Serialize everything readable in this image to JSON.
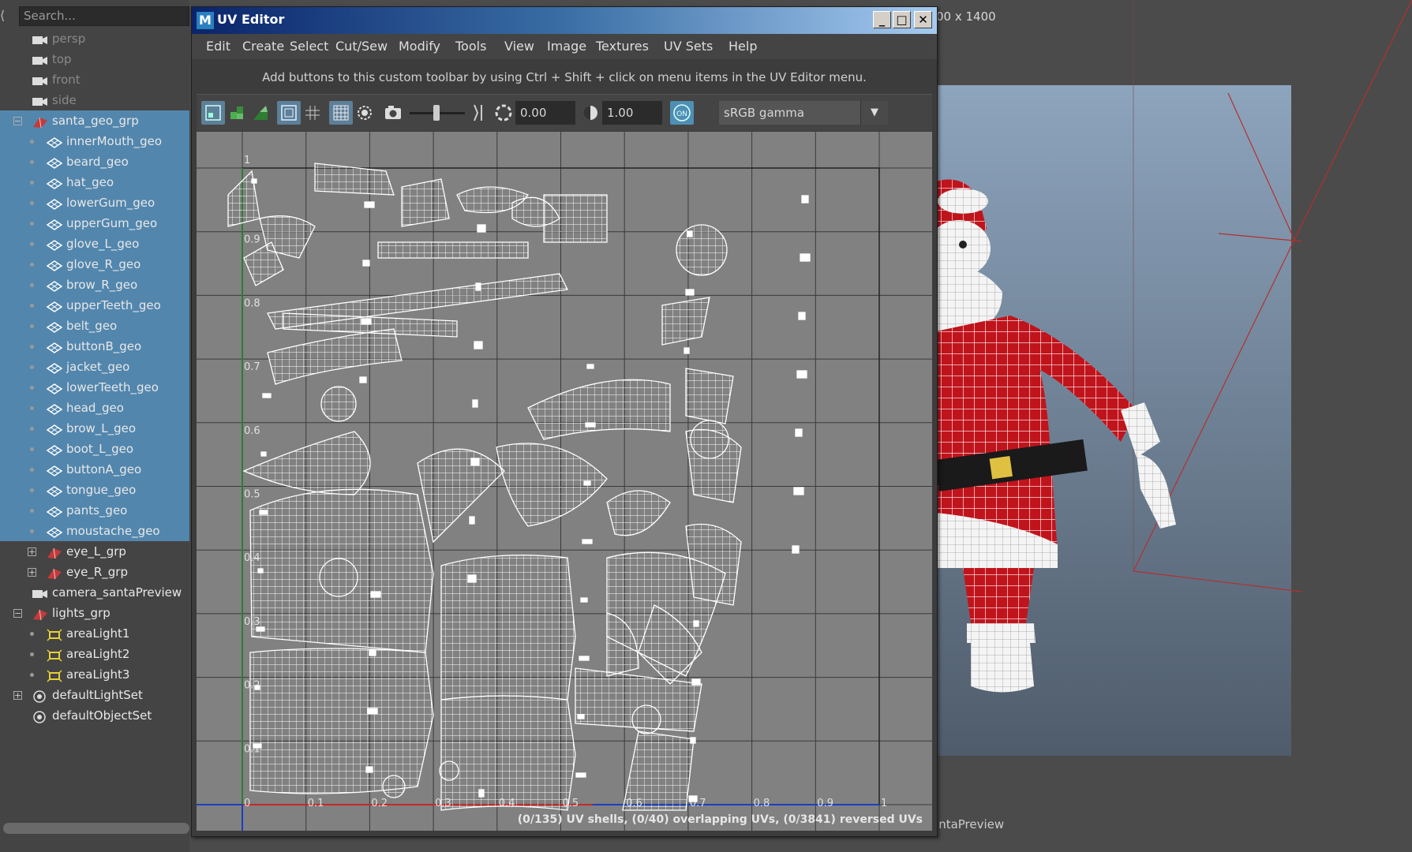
{
  "outliner": {
    "search_placeholder": "Search...",
    "rows": [
      {
        "label": "persp",
        "kind": "camera",
        "level": 0,
        "selected": false,
        "dim": true
      },
      {
        "label": "top",
        "kind": "camera",
        "level": 0,
        "selected": false,
        "dim": true
      },
      {
        "label": "front",
        "kind": "camera",
        "level": 0,
        "selected": false,
        "dim": true
      },
      {
        "label": "side",
        "kind": "camera",
        "level": 0,
        "selected": false,
        "dim": true
      },
      {
        "label": "santa_geo_grp",
        "kind": "group",
        "level": 0,
        "selected": true,
        "expander": "−"
      },
      {
        "label": "innerMouth_geo",
        "kind": "mesh",
        "level": 1,
        "selected": true
      },
      {
        "label": "beard_geo",
        "kind": "mesh",
        "level": 1,
        "selected": true
      },
      {
        "label": "hat_geo",
        "kind": "mesh",
        "level": 1,
        "selected": true
      },
      {
        "label": "lowerGum_geo",
        "kind": "mesh",
        "level": 1,
        "selected": true
      },
      {
        "label": "upperGum_geo",
        "kind": "mesh",
        "level": 1,
        "selected": true
      },
      {
        "label": "glove_L_geo",
        "kind": "mesh",
        "level": 1,
        "selected": true
      },
      {
        "label": "glove_R_geo",
        "kind": "mesh",
        "level": 1,
        "selected": true
      },
      {
        "label": "brow_R_geo",
        "kind": "mesh",
        "level": 1,
        "selected": true
      },
      {
        "label": "upperTeeth_geo",
        "kind": "mesh",
        "level": 1,
        "selected": true
      },
      {
        "label": "belt_geo",
        "kind": "mesh",
        "level": 1,
        "selected": true
      },
      {
        "label": "buttonB_geo",
        "kind": "mesh",
        "level": 1,
        "selected": true
      },
      {
        "label": "jacket_geo",
        "kind": "mesh",
        "level": 1,
        "selected": true
      },
      {
        "label": "lowerTeeth_geo",
        "kind": "mesh",
        "level": 1,
        "selected": true
      },
      {
        "label": "head_geo",
        "kind": "mesh",
        "level": 1,
        "selected": true
      },
      {
        "label": "brow_L_geo",
        "kind": "mesh",
        "level": 1,
        "selected": true
      },
      {
        "label": "boot_L_geo",
        "kind": "mesh",
        "level": 1,
        "selected": true
      },
      {
        "label": "buttonA_geo",
        "kind": "mesh",
        "level": 1,
        "selected": true
      },
      {
        "label": "tongue_geo",
        "kind": "mesh",
        "level": 1,
        "selected": true
      },
      {
        "label": "pants_geo",
        "kind": "mesh",
        "level": 1,
        "selected": true
      },
      {
        "label": "moustache_geo",
        "kind": "mesh",
        "level": 1,
        "selected": true
      },
      {
        "label": "eye_L_grp",
        "kind": "group",
        "level": 1,
        "selected": false,
        "expander": "+"
      },
      {
        "label": "eye_R_grp",
        "kind": "group",
        "level": 1,
        "selected": false,
        "expander": "+"
      },
      {
        "label": "camera_santaPreview",
        "kind": "camera",
        "level": 0,
        "selected": false
      },
      {
        "label": "lights_grp",
        "kind": "group",
        "level": 0,
        "selected": false,
        "expander": "−"
      },
      {
        "label": "areaLight1",
        "kind": "light",
        "level": 1,
        "selected": false
      },
      {
        "label": "areaLight2",
        "kind": "light",
        "level": 1,
        "selected": false
      },
      {
        "label": "areaLight3",
        "kind": "light",
        "level": 1,
        "selected": false
      },
      {
        "label": "defaultLightSet",
        "kind": "set",
        "level": 0,
        "selected": false,
        "expander": "+"
      },
      {
        "label": "defaultObjectSet",
        "kind": "set",
        "level": 0,
        "selected": false
      }
    ]
  },
  "viewport": {
    "resolution_label": "00 x 1400",
    "camera_label": "antaPreview"
  },
  "uv_editor": {
    "title": "UV Editor",
    "app_icon": "M",
    "window_buttons": {
      "minimize": "_",
      "maximize": "□",
      "close": "✕"
    },
    "menu": [
      "Edit",
      "Create",
      "Select",
      "Cut/Sew",
      "Modify",
      "Tools",
      "View",
      "Image",
      "Textures",
      "UV Sets",
      "Help"
    ],
    "hint": "Add buttons to this custom toolbar by using Ctrl + Shift + click on menu items in the UV Editor menu.",
    "toolbar": {
      "exposure_value": "0.00",
      "gamma_value": "1.00",
      "color_space": "sRGB gamma",
      "color_mgmt_badge": "ON"
    },
    "axis_ticks": {
      "u": [
        "0",
        "0.1",
        "0.2",
        "0.3",
        "0.4",
        "0.5",
        "0.6",
        "0.7",
        "0.8",
        "0.9",
        "1"
      ],
      "v": [
        "1",
        "0.9",
        "0.8",
        "0.7",
        "0.6",
        "0.5",
        "0.4",
        "0.3",
        "0.2",
        "0.1"
      ]
    },
    "status": "(0/135) UV shells, (0/40) overlapping UVs, (0/3841) reversed UVs"
  },
  "colors": {
    "selection": "#5286ad",
    "uv_wire": "#ffffff",
    "grid_bg": "#818181",
    "santa_red": "#c0141c",
    "u_axis": "#c62828",
    "v_axis": "#2e7d32"
  }
}
